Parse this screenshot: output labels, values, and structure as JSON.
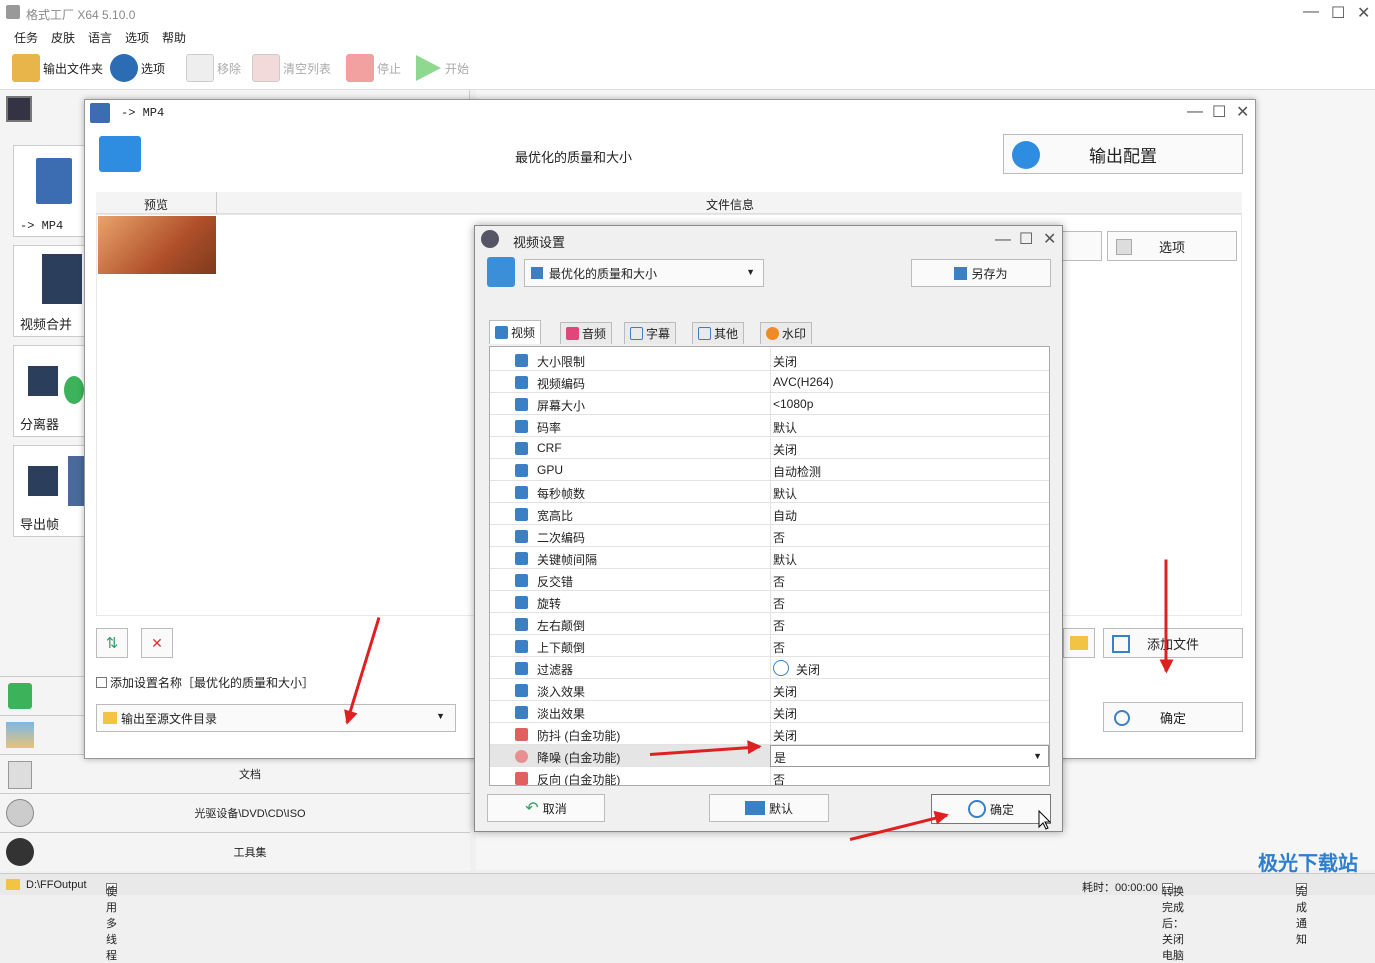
{
  "app": {
    "title": "格式工厂 X64 5.10.0"
  },
  "menu": [
    "任务",
    "皮肤",
    "语言",
    "选项",
    "帮助"
  ],
  "toolbar": {
    "output_folder": "输出文件夹",
    "options": "选项",
    "remove": "移除",
    "clear_list": "清空列表",
    "stop": "停止",
    "start": "开始"
  },
  "left": {
    "categories": [
      "-> MP4",
      "视频合并",
      "分离器",
      "导出帧"
    ],
    "bottom": [
      "文档",
      "光驱设备\\DVD\\CD\\ISO",
      "工具集"
    ]
  },
  "mp4": {
    "title": "-> MP4",
    "profile": "最优化的质量和大小",
    "output_config": "输出配置",
    "col_preview": "预览",
    "col_info": "文件信息",
    "options": "选项",
    "add_setting_name": "添加设置名称［最优化的质量和大小］",
    "output_dir": "输出至源文件目录",
    "add_file": "添加文件",
    "ok": "确定"
  },
  "vs": {
    "title": "视频设置",
    "profile": "最优化的质量和大小",
    "save_as": "另存为",
    "tabs": [
      "视频",
      "音频",
      "字幕",
      "其他",
      "水印"
    ],
    "rows": [
      {
        "name": "大小限制",
        "value": "关闭"
      },
      {
        "name": "视频编码",
        "value": "AVC(H264)"
      },
      {
        "name": "屏幕大小",
        "value": "<1080p"
      },
      {
        "name": "码率",
        "value": "默认"
      },
      {
        "name": "CRF",
        "value": "关闭"
      },
      {
        "name": "GPU",
        "value": "自动检测"
      },
      {
        "name": "每秒帧数",
        "value": "默认"
      },
      {
        "name": "宽高比",
        "value": "自动"
      },
      {
        "name": "二次编码",
        "value": "否"
      },
      {
        "name": "关键帧间隔",
        "value": "默认"
      },
      {
        "name": "反交错",
        "value": "否"
      },
      {
        "name": "旋转",
        "value": "否"
      },
      {
        "name": "左右颠倒",
        "value": "否"
      },
      {
        "name": "上下颠倒",
        "value": "否"
      },
      {
        "name": "过滤器",
        "value": "关闭"
      },
      {
        "name": "淡入效果",
        "value": "关闭"
      },
      {
        "name": "淡出效果",
        "value": "关闭"
      },
      {
        "name": "防抖 (白金功能)",
        "value": "关闭"
      },
      {
        "name": "降噪 (白金功能)",
        "value": "是"
      },
      {
        "name": "反向 (白金功能)",
        "value": "否"
      }
    ],
    "cancel": "取消",
    "default": "默认",
    "ok": "确定"
  },
  "status": {
    "path": "D:\\FFOutput",
    "multithread": "使用多线程",
    "time": "耗时：00:00:00",
    "after": "转换完成后：关闭电脑",
    "notify": "完成通知"
  },
  "watermark": "极光下载站"
}
